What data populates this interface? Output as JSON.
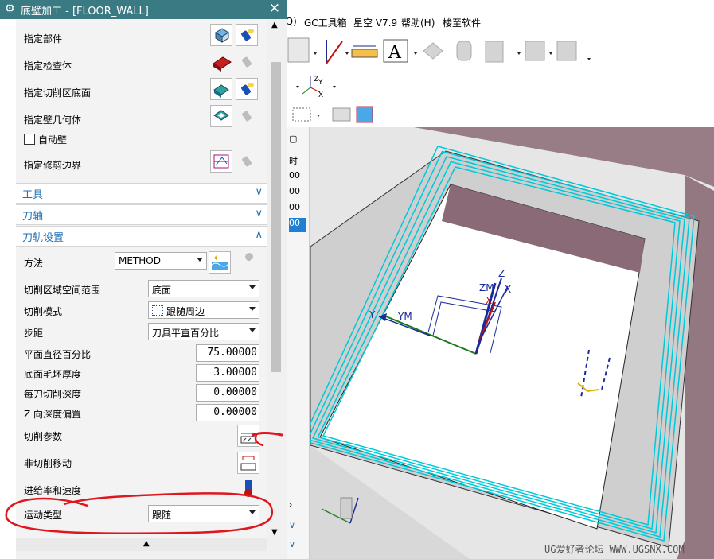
{
  "dialog": {
    "title": "底壁加工 - [FLOOR_WALL]",
    "specify_rows": [
      {
        "label": "指定部件"
      },
      {
        "label": "指定检查体"
      },
      {
        "label": "指定切削区底面"
      },
      {
        "label": "指定壁几何体"
      }
    ],
    "auto_wall_label": "自动壁",
    "trim_boundary_label": "指定修剪边界",
    "sections": {
      "tool": "工具",
      "axis": "刀轴",
      "path_settings": "刀轨设置"
    },
    "method": {
      "label": "方法",
      "value": "METHOD"
    },
    "fields": [
      {
        "label": "切削区域空间范围",
        "value": "底面"
      },
      {
        "label": "切削模式",
        "value": "跟随周边"
      },
      {
        "label": "步距",
        "value": "刀具平直百分比"
      }
    ],
    "numeric_fields": [
      {
        "label": "平面直径百分比",
        "value": "75.00000"
      },
      {
        "label": "底面毛坯厚度",
        "value": "3.00000"
      },
      {
        "label": "每刀切削深度",
        "value": "0.00000"
      },
      {
        "label": "Z 向深度偏置",
        "value": "0.00000"
      }
    ],
    "action_rows": [
      {
        "label": "切削参数"
      },
      {
        "label": "非切削移动"
      },
      {
        "label": "进给率和速度"
      }
    ],
    "motion_type": {
      "label": "运动类型",
      "value": "跟随"
    },
    "annotation_color": "#e0161f"
  },
  "app": {
    "menus": [
      "(Q)",
      "GC工具箱",
      "星空 V7.9",
      "帮助(H)",
      "楼至软件"
    ],
    "nav_cells": [
      "时",
      "00",
      "00",
      "00",
      "00"
    ],
    "watermark": "UG爱好者论坛 WWW.UGSNX.COM",
    "axis_labels": {
      "z": "Z",
      "zm": "ZM",
      "x": "X",
      "y": "Y",
      "ym": "YM"
    },
    "toolpath_color": "#00c8d8",
    "wall_color": "#8a6a76"
  }
}
